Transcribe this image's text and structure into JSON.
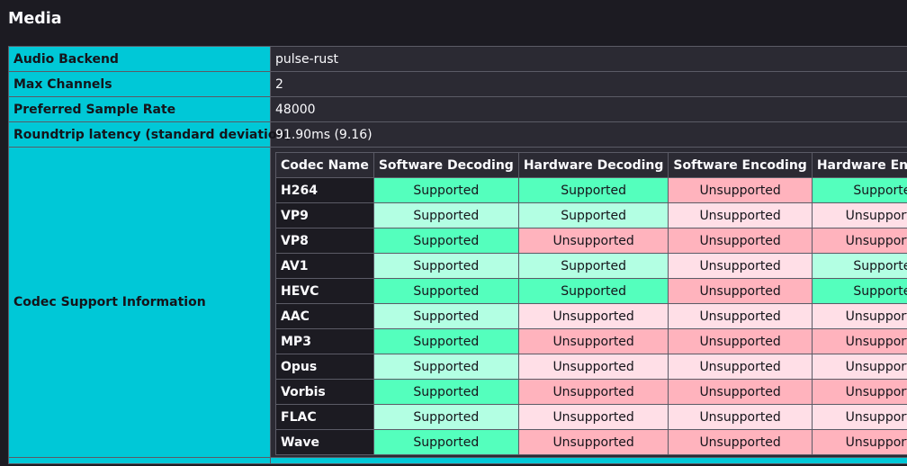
{
  "title": "Media",
  "info": {
    "audio_backend": {
      "label": "Audio Backend",
      "value": "pulse-rust"
    },
    "max_channels": {
      "label": "Max Channels",
      "value": "2"
    },
    "sample_rate": {
      "label": "Preferred Sample Rate",
      "value": "48000"
    },
    "latency": {
      "label": "Roundtrip latency (standard deviation)",
      "value": "91.90ms (9.16)"
    },
    "codec_support": {
      "label": "Codec Support Information"
    }
  },
  "codec_table": {
    "headers": [
      "Codec Name",
      "Software Decoding",
      "Hardware Decoding",
      "Software Encoding",
      "Hardware Encoding"
    ],
    "rows": [
      {
        "name": "H264",
        "cells": [
          "Supported",
          "Supported",
          "Unsupported",
          "Supported"
        ]
      },
      {
        "name": "VP9",
        "cells": [
          "Supported",
          "Supported",
          "Unsupported",
          "Unsupported"
        ]
      },
      {
        "name": "VP8",
        "cells": [
          "Supported",
          "Unsupported",
          "Unsupported",
          "Unsupported"
        ]
      },
      {
        "name": "AV1",
        "cells": [
          "Supported",
          "Supported",
          "Unsupported",
          "Supported"
        ]
      },
      {
        "name": "HEVC",
        "cells": [
          "Supported",
          "Supported",
          "Unsupported",
          "Supported"
        ]
      },
      {
        "name": "AAC",
        "cells": [
          "Supported",
          "Unsupported",
          "Unsupported",
          "Unsupported"
        ]
      },
      {
        "name": "MP3",
        "cells": [
          "Supported",
          "Unsupported",
          "Unsupported",
          "Unsupported"
        ]
      },
      {
        "name": "Opus",
        "cells": [
          "Supported",
          "Unsupported",
          "Unsupported",
          "Unsupported"
        ]
      },
      {
        "name": "Vorbis",
        "cells": [
          "Supported",
          "Unsupported",
          "Unsupported",
          "Unsupported"
        ]
      },
      {
        "name": "FLAC",
        "cells": [
          "Supported",
          "Unsupported",
          "Unsupported",
          "Unsupported"
        ]
      },
      {
        "name": "Wave",
        "cells": [
          "Supported",
          "Unsupported",
          "Unsupported",
          "Unsupported"
        ]
      }
    ]
  },
  "colors": {
    "background": "#1c1b22",
    "label_cyan": "#00c8d7",
    "value_bg": "#2b2a33",
    "supported_strong": "#54ffbd",
    "supported_light": "#b3ffe3",
    "unsupported_strong": "#ffb3bd",
    "unsupported_light": "#ffdfe7"
  }
}
